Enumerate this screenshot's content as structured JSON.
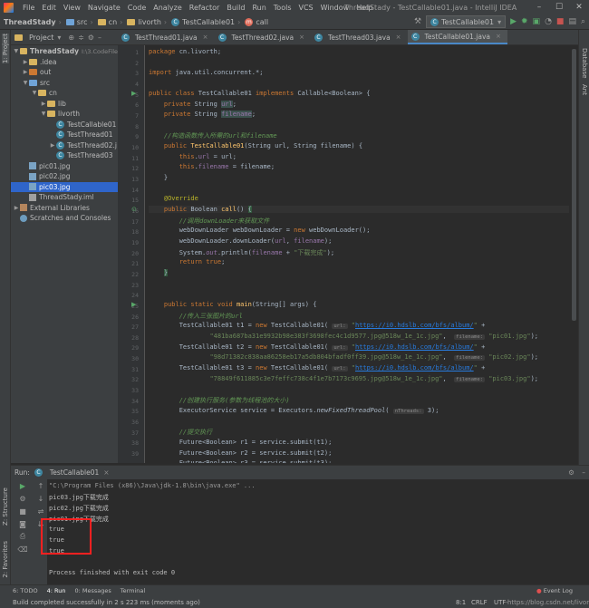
{
  "colors": {
    "background": "#2b2b2b",
    "panel": "#3c3f41",
    "selection": "#2f65ca",
    "keyword": "#cc7832",
    "string": "#6a8759",
    "field": "#9876aa",
    "annotation": "#bbb529",
    "highlight_box": "#ff2020"
  },
  "menubar": {
    "items": [
      "File",
      "Edit",
      "View",
      "Navigate",
      "Code",
      "Analyze",
      "Refactor",
      "Build",
      "Run",
      "Tools",
      "VCS",
      "Window",
      "Help"
    ],
    "title": "ThreadStady - TestCallable01.java - IntelliJ IDEA"
  },
  "breadcrumbs": [
    "ThreadStady",
    "src",
    "cn",
    "livorth",
    "TestCallable01",
    "call"
  ],
  "run_config": "TestCallable01",
  "project": {
    "header": "Project",
    "tree": [
      {
        "label": "ThreadStady",
        "extra": "I:\\3.CodeFile",
        "arrow": "▼",
        "indent": 0,
        "icon": "folder-module"
      },
      {
        "label": ".idea",
        "arrow": "▶",
        "indent": 1,
        "icon": "folder"
      },
      {
        "label": "out",
        "arrow": "▶",
        "indent": 1,
        "icon": "folder-orange"
      },
      {
        "label": "src",
        "arrow": "▼",
        "indent": 1,
        "icon": "folder-blue"
      },
      {
        "label": "cn",
        "arrow": "▼",
        "indent": 2,
        "icon": "folder"
      },
      {
        "label": "lib",
        "arrow": "▶",
        "indent": 3,
        "icon": "folder"
      },
      {
        "label": "livorth",
        "arrow": "▼",
        "indent": 3,
        "icon": "folder"
      },
      {
        "label": "TestCallable01",
        "arrow": "",
        "indent": 4,
        "icon": "class"
      },
      {
        "label": "TestThread01",
        "arrow": "",
        "indent": 4,
        "icon": "class"
      },
      {
        "label": "TestThread02.j",
        "arrow": "▶",
        "indent": 4,
        "icon": "class"
      },
      {
        "label": "TestThread03",
        "arrow": "",
        "indent": 4,
        "icon": "class"
      },
      {
        "label": "pic01.jpg",
        "arrow": "",
        "indent": 1,
        "icon": "image"
      },
      {
        "label": "pic02.jpg",
        "arrow": "",
        "indent": 1,
        "icon": "image"
      },
      {
        "label": "pic03.jpg",
        "arrow": "",
        "indent": 1,
        "icon": "image",
        "selected": true
      },
      {
        "label": "ThreadStady.iml",
        "arrow": "",
        "indent": 1,
        "icon": "iml"
      },
      {
        "label": "External Libraries",
        "arrow": "▶",
        "indent": 0,
        "icon": "library"
      },
      {
        "label": "Scratches and Consoles",
        "arrow": "",
        "indent": 0,
        "icon": "scratch"
      }
    ]
  },
  "tabs": [
    {
      "label": "TestThread01.java",
      "active": false
    },
    {
      "label": "TestThread02.java",
      "active": false
    },
    {
      "label": "TestThread03.java",
      "active": false
    },
    {
      "label": "TestCallable01.java",
      "active": true
    }
  ],
  "code": {
    "line_numbers": [
      "1",
      "2",
      "3",
      "4",
      "5",
      "6",
      "7",
      "8",
      "9",
      "10",
      "11",
      "12",
      "13",
      "14",
      "15",
      "16",
      "17",
      "18",
      "19",
      "20",
      "21",
      "22",
      "23",
      "24",
      "25",
      "26",
      "27",
      "28",
      "29",
      "30",
      "31",
      "32",
      "33",
      "34",
      "35",
      "36",
      "37",
      "38",
      "39"
    ]
  },
  "run": {
    "label": "Run:",
    "tab": "TestCallable01",
    "output": [
      "\"C:\\Program Files (x86)\\Java\\jdk-1.8\\bin\\java.exe\" ...",
      "pic03.jpg下载完成",
      "pic02.jpg下载完成",
      "pic01.jpg下载完成",
      "true",
      "true",
      "true",
      "",
      "Process finished with exit code 0"
    ]
  },
  "left_strip": {
    "project": "1: Project",
    "structure": "Z: Structure",
    "favorites": "2: Favorites"
  },
  "right_strip": {
    "database": "Database",
    "ant": "Ant"
  },
  "toolbar": {
    "todo": "6: TODO",
    "run": "4: Run",
    "messages": "0: Messages",
    "terminal": "Terminal",
    "eventlog": "Event Log"
  },
  "status": {
    "message": "Build completed successfully in 2 s 223 ms (moments ago)",
    "position": "8:1",
    "le": "CRLF",
    "enc": "UTF-8",
    "watermark": "https://blog.csdn.net/livorth"
  }
}
